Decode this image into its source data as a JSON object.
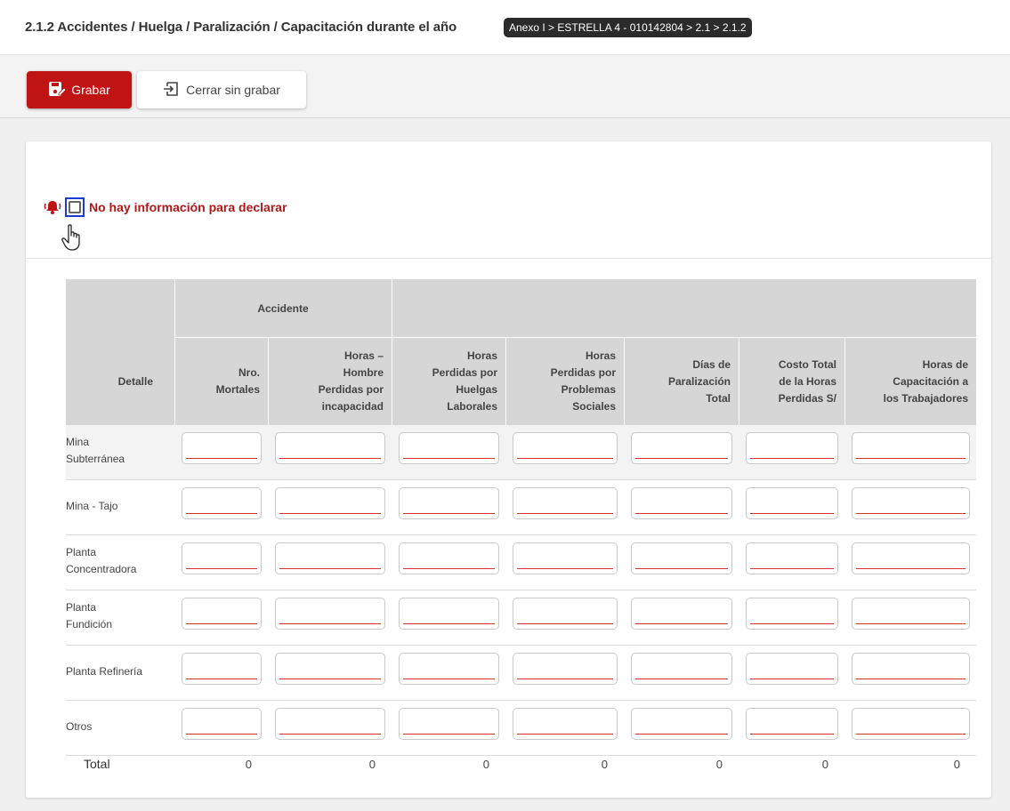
{
  "header": {
    "title": "2.1.2 Accidentes / Huelga / Paralización / Capacitación durante el año",
    "breadcrumb": "Anexo I > ESTRELLA 4 - 010142804 > 2.1 > 2.1.2"
  },
  "toolbar": {
    "save_label": "Grabar",
    "close_label": "Cerrar sin grabar"
  },
  "form": {
    "no_info_label": "No hay información para declarar",
    "no_info_checked": false
  },
  "table": {
    "group_header": "Accidente",
    "detail_header": "Detalle",
    "columns": [
      [
        "Nro.",
        "Mortales"
      ],
      [
        "Horas –",
        "Hombre",
        "Perdidas por",
        "incapacidad"
      ],
      [
        "Horas",
        "Perdidas por",
        "Huelgas",
        "Laborales"
      ],
      [
        "Horas",
        "Perdidas por",
        "Problemas",
        "Sociales"
      ],
      [
        "Días de",
        "Paralización",
        "Total"
      ],
      [
        "Costo Total",
        "de la Horas",
        "Perdidas S/"
      ],
      [
        "Horas de",
        "Capacitación a",
        "los Trabajadores"
      ]
    ],
    "rows": [
      [
        "Mina",
        "Subterránea"
      ],
      [
        "Mina - Tajo"
      ],
      [
        "Planta",
        "Concentradora"
      ],
      [
        "Planta",
        "Fundición"
      ],
      [
        "Planta Refinería"
      ],
      [
        "Otros"
      ]
    ],
    "total_label": "Total",
    "totals": [
      "0",
      "0",
      "0",
      "0",
      "0",
      "0",
      "0"
    ]
  },
  "colors": {
    "accent": "#c01313",
    "alert_text": "#b01818",
    "header_bg": "#d6d6d6",
    "focus_border": "#1a3cd6"
  },
  "icons": {
    "save": "save-icon",
    "close": "exit-icon",
    "bell": "bell-icon",
    "cursor": "hand-pointer-icon"
  }
}
